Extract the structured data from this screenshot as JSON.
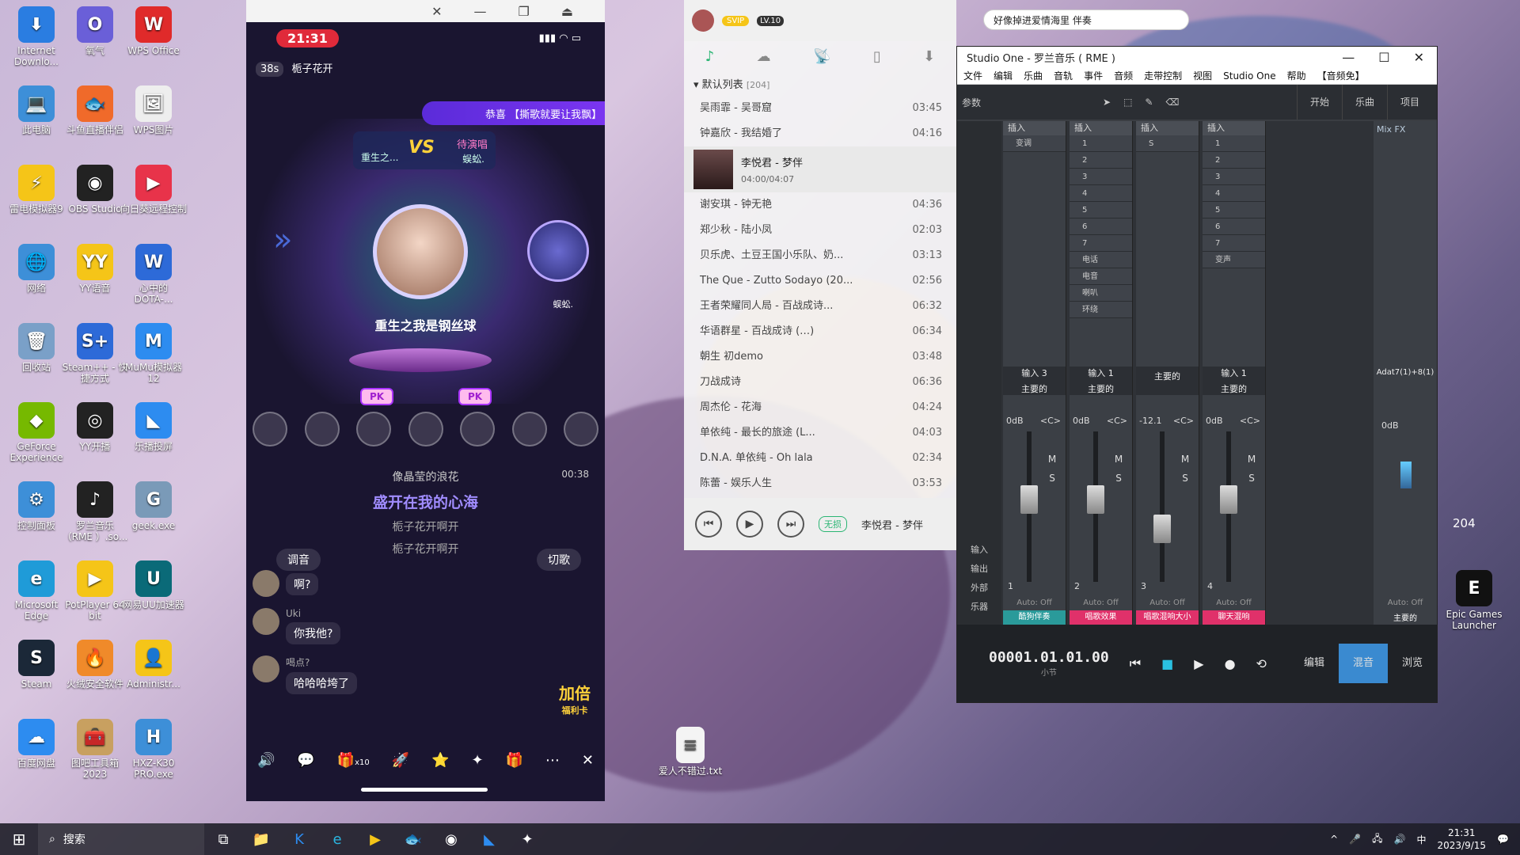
{
  "desktop_icons": [
    {
      "label": "Internet Downlo...",
      "color": "#2a7de1",
      "glyph": "⬇"
    },
    {
      "label": "此电脑",
      "color": "#3d8fd8",
      "glyph": "💻"
    },
    {
      "label": "雷电模拟器9",
      "color": "#f5c518",
      "glyph": "⚡"
    },
    {
      "label": "网络",
      "color": "#3d8fd8",
      "glyph": "🌐"
    },
    {
      "label": "回收站",
      "color": "#7aa0c8",
      "glyph": "🗑"
    },
    {
      "label": "GeForce Experience",
      "color": "#76b900",
      "glyph": "◆"
    },
    {
      "label": "控制面板",
      "color": "#3d8fd8",
      "glyph": "⚙"
    },
    {
      "label": "Microsoft Edge",
      "color": "#1f9bd8",
      "glyph": "e"
    },
    {
      "label": "Steam",
      "color": "#1b2838",
      "glyph": "S"
    },
    {
      "label": "百度网盘",
      "color": "#2d8cf0",
      "glyph": "☁"
    },
    {
      "label": "氧气",
      "color": "#6a5fd8",
      "glyph": "O"
    },
    {
      "label": "斗鱼直播伴侣",
      "color": "#f06a2a",
      "glyph": "🐟"
    },
    {
      "label": "OBS Studio",
      "color": "#222",
      "glyph": "◉"
    },
    {
      "label": "YY语音",
      "color": "#f5c518",
      "glyph": "YY"
    },
    {
      "label": "Steam++ - 快捷方式",
      "color": "#2d6ad8",
      "glyph": "S+"
    },
    {
      "label": "YY开播",
      "color": "#222",
      "glyph": "◎"
    },
    {
      "label": "罗兰音乐（RME ）.so...",
      "color": "#222",
      "glyph": "♪"
    },
    {
      "label": "PotPlayer 64 bit",
      "color": "#f5c518",
      "glyph": "▶"
    },
    {
      "label": "火绒安全软件",
      "color": "#f08a2a",
      "glyph": "🔥"
    },
    {
      "label": "图吧工具箱2023",
      "color": "#c8a060",
      "glyph": "🧰"
    },
    {
      "label": "WPS Office",
      "color": "#e02a2a",
      "glyph": "W"
    },
    {
      "label": "WPS图片",
      "color": "#eee",
      "glyph": "🖼"
    },
    {
      "label": "向日葵远程控制",
      "color": "#e8334a",
      "glyph": "▶"
    },
    {
      "label": "心中的DOTA-...",
      "color": "#2d6ad8",
      "glyph": "W"
    },
    {
      "label": "MuMu模拟器12",
      "color": "#2d8cf0",
      "glyph": "M"
    },
    {
      "label": "乐播投屏",
      "color": "#2d8cf0",
      "glyph": "◣"
    },
    {
      "label": "geek.exe",
      "color": "#7a9ab8",
      "glyph": "G"
    },
    {
      "label": "网易UU加速器",
      "color": "#0a6a78",
      "glyph": "U"
    },
    {
      "label": "Administr...",
      "color": "#f5c518",
      "glyph": "👤"
    },
    {
      "label": "HXZ-K30 PRO.exe",
      "color": "#3d8fd8",
      "glyph": "H"
    }
  ],
  "phone": {
    "time": "21:31",
    "room_timer": "38s",
    "room_name": "栀子花开",
    "banner": "恭喜 【撕歌就要让我飘】",
    "vs_left": "重生之...",
    "vs_right_status": "待演唱",
    "vs_right_name": "蜈蚣.",
    "singer_name": "重生之我是钢丝球",
    "small_name": "蜈蚣.",
    "pk_label": "PK",
    "lyric_prev": "像晶莹的浪花",
    "lyric_current": "盛开在我的心海",
    "lyric_next1": "栀子花开啊开",
    "lyric_next2": "栀子花开啊开",
    "lyric_time": "00:38",
    "btn_tune": "调音",
    "btn_switch": "切歌",
    "chats": [
      {
        "name": "",
        "msg": "啊?"
      },
      {
        "name": "Uki",
        "msg": "你我他?"
      },
      {
        "name": "喝点?",
        "msg": "哈哈哈垮了"
      }
    ],
    "double_badge": "加倍",
    "double_sub": "福利卡",
    "bottom_x10": "x10"
  },
  "music": {
    "vip": "SVIP",
    "level": "LV.10",
    "search": "好像掉进爱情海里 伴奏",
    "playlist_title": "默认列表",
    "playlist_count": "[204]",
    "active_song": "李悦君 - 梦伴",
    "active_time": "04:00/04:07",
    "songs_before": [
      {
        "title": "吴雨霏 - 吴哥窟",
        "time": "03:45"
      },
      {
        "title": "钟嘉欣 - 我结婚了",
        "time": "04:16"
      }
    ],
    "songs_after": [
      {
        "title": "谢安琪 - 钟无艳",
        "time": "04:36"
      },
      {
        "title": "郑少秋 - 陆小凤",
        "time": "02:03"
      },
      {
        "title": "贝乐虎、土豆王国小乐队、奶...",
        "time": "03:13"
      },
      {
        "title": "The Que - Zutto Sodayo (20...",
        "time": "02:56"
      },
      {
        "title": "王者荣耀同人局 - 百战成诗...",
        "time": "06:32"
      },
      {
        "title": "华语群星 - 百战成诗 (…)",
        "time": "06:34"
      },
      {
        "title": "朝生 初demo",
        "time": "03:48"
      },
      {
        "title": "刀战成诗",
        "time": "06:36"
      },
      {
        "title": "周杰伦 - 花海",
        "time": "04:24"
      },
      {
        "title": "单依纯 - 最长的旅途 (L...",
        "time": "04:03"
      },
      {
        "title": "D.N.A. 单依纯 - Oh lala",
        "time": "02:34"
      },
      {
        "title": "陈蕾 - 娱乐人生",
        "time": "03:53"
      }
    ],
    "now_playing": "李悦君 - 梦伴",
    "lossless": "无损"
  },
  "studio": {
    "title": "Studio One - 罗兰音乐 ( RME )",
    "menu": [
      "文件",
      "编辑",
      "乐曲",
      "音轨",
      "事件",
      "音频",
      "走带控制",
      "视图",
      "Studio One",
      "帮助",
      "【音频免】"
    ],
    "toolbar_label": "参数",
    "tabs": [
      "开始",
      "乐曲",
      "项目"
    ],
    "insert_label": "插入",
    "mixfx": "Mix FX",
    "channels": [
      {
        "input": "输入 3",
        "bus": "主要的",
        "db": "0dB",
        "pan": "<C>",
        "num": "1",
        "auto": "Auto: Off",
        "name": "酷狗伴奏",
        "color": "#2a9a9a",
        "slots": [
          "变调"
        ],
        "fader": 0.55
      },
      {
        "input": "输入 1",
        "bus": "主要的",
        "db": "0dB",
        "pan": "<C>",
        "num": "2",
        "auto": "Auto: Off",
        "name": "唱歌效果",
        "color": "#e0316a",
        "slots": [
          "1",
          "2",
          "3",
          "4",
          "5",
          "6",
          "7",
          "电话",
          "电音",
          "喇叭",
          "环绕"
        ],
        "fader": 0.55
      },
      {
        "input": "",
        "bus": "主要的",
        "db": "-12.1",
        "pan": "<C>",
        "num": "3",
        "auto": "Auto: Off",
        "name": "唱歌混响大小",
        "color": "#e0316a",
        "slots": [
          "S"
        ],
        "fader": 0.3
      },
      {
        "input": "输入 1",
        "bus": "主要的",
        "db": "0dB",
        "pan": "<C>",
        "num": "4",
        "auto": "Auto: Off",
        "name": "聊天混响",
        "color": "#e0316a",
        "slots": [
          "1",
          "2",
          "3",
          "4",
          "5",
          "6",
          "7",
          "变声"
        ],
        "fader": 0.55
      }
    ],
    "master": {
      "input": "Adat7(1)+8(1)",
      "db": "0dB",
      "auto": "Auto: Off",
      "name": "主要的"
    },
    "side_labels": [
      "输入",
      "输出",
      "外部",
      "乐器"
    ],
    "transport_time": "00001.01.01.00",
    "transport_unit": "小节",
    "bottom_tabs": [
      "编辑",
      "混音",
      "浏览"
    ]
  },
  "desktop_file": "爱人不错过.txt",
  "epic": "Epic Games Launcher",
  "taskbar": {
    "search": "搜索",
    "time": "21:31",
    "date": "2023/9/15",
    "ime": "中"
  },
  "right_partial": {
    "badge": "204"
  }
}
